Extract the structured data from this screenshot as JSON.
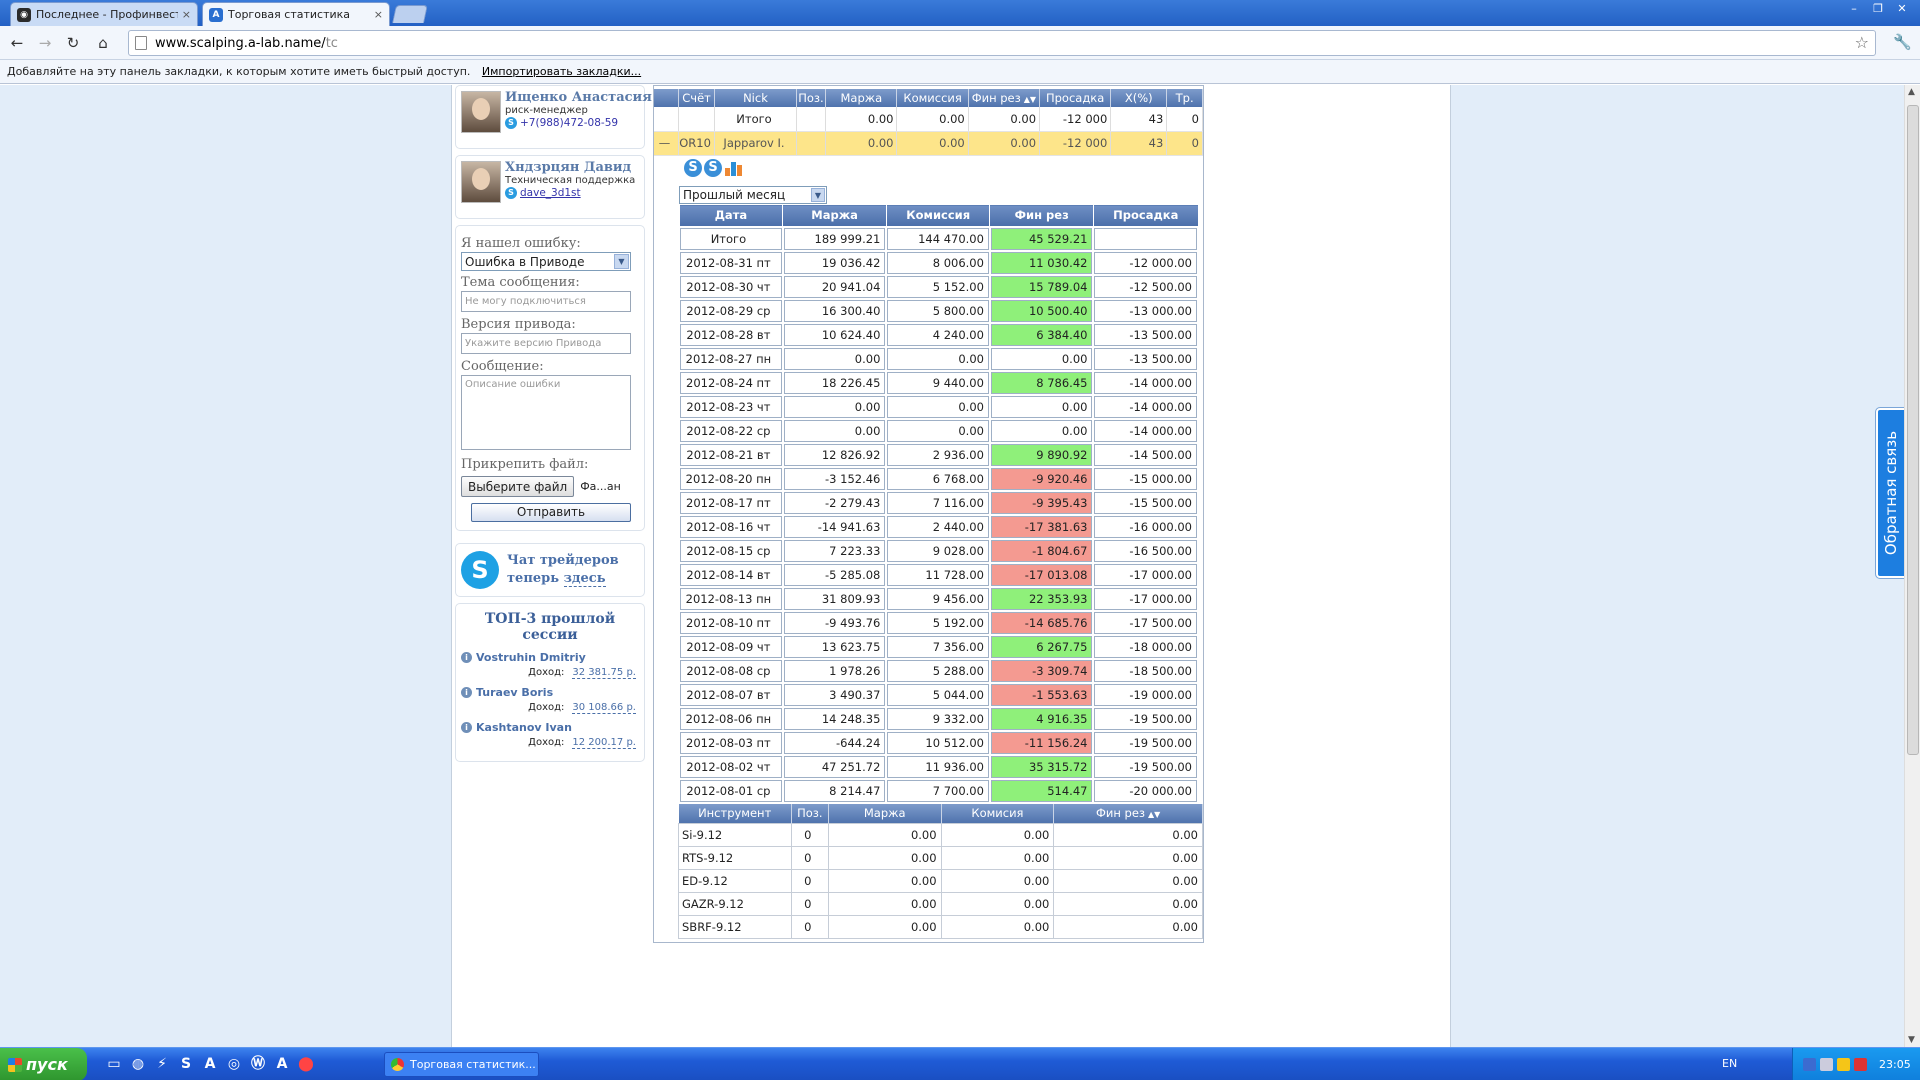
{
  "browser": {
    "tabs": [
      {
        "label": "Последнее - Профинвест",
        "active": false,
        "close": "×"
      },
      {
        "label": "Торговая статистика",
        "active": true,
        "close": "×"
      }
    ],
    "url_host": "www.scalping.a-lab.name/",
    "url_path": "tc",
    "bookmarks_text": "Добавляйте на эту панель закладки, к которым хотите иметь быстрый доступ.",
    "bookmarks_link": "Импортировать закладки..."
  },
  "sidebar": {
    "contacts": [
      {
        "name": "Ищенко Анастасия",
        "role": "риск-менеджер",
        "contact": "+7(988)472-08-59"
      },
      {
        "name": "Хндзрцян Давид",
        "role": "Техническая поддержка",
        "contact": "dave_3d1st"
      }
    ],
    "form": {
      "found_error_label": "Я нашел ошибку:",
      "error_type_value": "Ошибка в Приводе",
      "subject_label": "Тема сообщения:",
      "subject_placeholder": "Не могу подключиться",
      "version_label": "Версия привода:",
      "version_placeholder": "Укажите версию Привода",
      "message_label": "Сообщение:",
      "message_placeholder": "Описание ошибки",
      "attach_label": "Прикрепить файл:",
      "choose_file_button": "Выберите файл",
      "file_name_text": "Фа...ан",
      "send_button": "Отправить"
    },
    "chat": {
      "line1": "Чат трейдеров",
      "line2_pre": "теперь ",
      "line2_link": "здесь"
    },
    "top3": {
      "title": "ТОП-3 прошлой сессии",
      "income_label": "Доход:",
      "items": [
        {
          "name": "Vostruhin Dmitriy",
          "income": "32 381.75 р."
        },
        {
          "name": "Turaev Boris",
          "income": "30 108.66 р."
        },
        {
          "name": "Kashtanov Ivan",
          "income": "12 200.17 р."
        }
      ]
    }
  },
  "account_table": {
    "headers": [
      "Счёт",
      "Nick",
      "Поз.",
      "Маржа",
      "Комиссия",
      "Фин рез",
      "Просадка",
      "X(%)",
      "Тр."
    ],
    "total_row": {
      "account": "",
      "nick": "Итого",
      "pos": "",
      "margin": "0.00",
      "commission": "0.00",
      "fin": "0.00",
      "drawdown": "-12 000",
      "x": "43",
      "tr": "0"
    },
    "rows": [
      {
        "collapse": "—",
        "account": "OR10",
        "nick": "Japparov I.",
        "pos": "",
        "margin": "0.00",
        "commission": "0.00",
        "fin": "0.00",
        "drawdown": "-12 000",
        "x": "43",
        "tr": "0"
      }
    ]
  },
  "period_select": {
    "value": "Прошлый месяц"
  },
  "daily_table": {
    "headers": [
      "Дата",
      "Маржа",
      "Комиссия",
      "Фин рез",
      "Просадка"
    ],
    "total": {
      "date": "Итого",
      "margin": "189 999.21",
      "commission": "144 470.00",
      "fin": "45 529.21",
      "drawdown": "",
      "sign": "pos"
    },
    "rows": [
      {
        "date": "2012-08-31 пт",
        "margin": "19 036.42",
        "commission": "8 006.00",
        "fin": "11 030.42",
        "drawdown": "-12 000.00",
        "sign": "pos"
      },
      {
        "date": "2012-08-30 чт",
        "margin": "20 941.04",
        "commission": "5 152.00",
        "fin": "15 789.04",
        "drawdown": "-12 500.00",
        "sign": "pos"
      },
      {
        "date": "2012-08-29 ср",
        "margin": "16 300.40",
        "commission": "5 800.00",
        "fin": "10 500.40",
        "drawdown": "-13 000.00",
        "sign": "pos"
      },
      {
        "date": "2012-08-28 вт",
        "margin": "10 624.40",
        "commission": "4 240.00",
        "fin": "6 384.40",
        "drawdown": "-13 500.00",
        "sign": "pos"
      },
      {
        "date": "2012-08-27 пн",
        "margin": "0.00",
        "commission": "0.00",
        "fin": "0.00",
        "drawdown": "-13 500.00",
        "sign": "zero"
      },
      {
        "date": "2012-08-24 пт",
        "margin": "18 226.45",
        "commission": "9 440.00",
        "fin": "8 786.45",
        "drawdown": "-14 000.00",
        "sign": "pos"
      },
      {
        "date": "2012-08-23 чт",
        "margin": "0.00",
        "commission": "0.00",
        "fin": "0.00",
        "drawdown": "-14 000.00",
        "sign": "zero"
      },
      {
        "date": "2012-08-22 ср",
        "margin": "0.00",
        "commission": "0.00",
        "fin": "0.00",
        "drawdown": "-14 000.00",
        "sign": "zero"
      },
      {
        "date": "2012-08-21 вт",
        "margin": "12 826.92",
        "commission": "2 936.00",
        "fin": "9 890.92",
        "drawdown": "-14 500.00",
        "sign": "pos"
      },
      {
        "date": "2012-08-20 пн",
        "margin": "-3 152.46",
        "commission": "6 768.00",
        "fin": "-9 920.46",
        "drawdown": "-15 000.00",
        "sign": "neg"
      },
      {
        "date": "2012-08-17 пт",
        "margin": "-2 279.43",
        "commission": "7 116.00",
        "fin": "-9 395.43",
        "drawdown": "-15 500.00",
        "sign": "neg"
      },
      {
        "date": "2012-08-16 чт",
        "margin": "-14 941.63",
        "commission": "2 440.00",
        "fin": "-17 381.63",
        "drawdown": "-16 000.00",
        "sign": "neg"
      },
      {
        "date": "2012-08-15 ср",
        "margin": "7 223.33",
        "commission": "9 028.00",
        "fin": "-1 804.67",
        "drawdown": "-16 500.00",
        "sign": "neg"
      },
      {
        "date": "2012-08-14 вт",
        "margin": "-5 285.08",
        "commission": "11 728.00",
        "fin": "-17 013.08",
        "drawdown": "-17 000.00",
        "sign": "neg"
      },
      {
        "date": "2012-08-13 пн",
        "margin": "31 809.93",
        "commission": "9 456.00",
        "fin": "22 353.93",
        "drawdown": "-17 000.00",
        "sign": "pos"
      },
      {
        "date": "2012-08-10 пт",
        "margin": "-9 493.76",
        "commission": "5 192.00",
        "fin": "-14 685.76",
        "drawdown": "-17 500.00",
        "sign": "neg"
      },
      {
        "date": "2012-08-09 чт",
        "margin": "13 623.75",
        "commission": "7 356.00",
        "fin": "6 267.75",
        "drawdown": "-18 000.00",
        "sign": "pos"
      },
      {
        "date": "2012-08-08 ср",
        "margin": "1 978.26",
        "commission": "5 288.00",
        "fin": "-3 309.74",
        "drawdown": "-18 500.00",
        "sign": "neg"
      },
      {
        "date": "2012-08-07 вт",
        "margin": "3 490.37",
        "commission": "5 044.00",
        "fin": "-1 553.63",
        "drawdown": "-19 000.00",
        "sign": "neg"
      },
      {
        "date": "2012-08-06 пн",
        "margin": "14 248.35",
        "commission": "9 332.00",
        "fin": "4 916.35",
        "drawdown": "-19 500.00",
        "sign": "pos"
      },
      {
        "date": "2012-08-03 пт",
        "margin": "-644.24",
        "commission": "10 512.00",
        "fin": "-11 156.24",
        "drawdown": "-19 500.00",
        "sign": "neg"
      },
      {
        "date": "2012-08-02 чт",
        "margin": "47 251.72",
        "commission": "11 936.00",
        "fin": "35 315.72",
        "drawdown": "-19 500.00",
        "sign": "pos"
      },
      {
        "date": "2012-08-01 ср",
        "margin": "8 214.47",
        "commission": "7 700.00",
        "fin": "514.47",
        "drawdown": "-20 000.00",
        "sign": "pos"
      }
    ]
  },
  "instrument_table": {
    "headers": [
      "Инструмент",
      "Поз.",
      "Маржа",
      "Комисия",
      "Фин рез"
    ],
    "rows": [
      {
        "instrument": "Si-9.12",
        "pos": "0",
        "margin": "0.00",
        "commission": "0.00",
        "fin": "0.00"
      },
      {
        "instrument": "RTS-9.12",
        "pos": "0",
        "margin": "0.00",
        "commission": "0.00",
        "fin": "0.00"
      },
      {
        "instrument": "ED-9.12",
        "pos": "0",
        "margin": "0.00",
        "commission": "0.00",
        "fin": "0.00"
      },
      {
        "instrument": "GAZR-9.12",
        "pos": "0",
        "margin": "0.00",
        "commission": "0.00",
        "fin": "0.00"
      },
      {
        "instrument": "SBRF-9.12",
        "pos": "0",
        "margin": "0.00",
        "commission": "0.00",
        "fin": "0.00"
      }
    ]
  },
  "feedback_tab": "Обратная связь",
  "taskbar": {
    "start": "пуск",
    "task_item": "Торговая статистик...",
    "lang": "EN",
    "clock": "23:05"
  },
  "colors": {
    "positive": "#8ff07a",
    "negative": "#f49a91",
    "highlight_row": "#fde58a",
    "header": "#4f73ad"
  }
}
